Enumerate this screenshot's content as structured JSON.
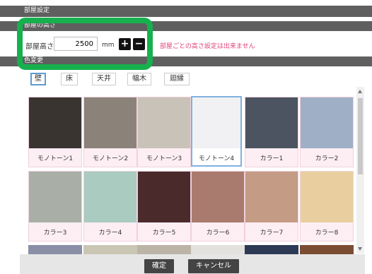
{
  "header": {
    "title": "部屋設定",
    "section_height": "部屋の高さ",
    "section_color": "色変更"
  },
  "height": {
    "label": "部屋高さ",
    "value": "2500",
    "unit": "mm",
    "plus": "+",
    "minus": "−",
    "warning": "部屋ごとの高さ設定は出来ません"
  },
  "tabs": [
    "壁",
    "床",
    "天井",
    "幅木",
    "廻縁"
  ],
  "tiles_row1": [
    {
      "label": "モノトーン1",
      "color": "#3a3431"
    },
    {
      "label": "モノトーン2",
      "color": "#8b8379"
    },
    {
      "label": "モノトーン3",
      "color": "#c8c2b9"
    },
    {
      "label": "モノトーン4",
      "color": "#f1f1f3"
    },
    {
      "label": "カラー1",
      "color": "#4c5461"
    },
    {
      "label": "カラー2",
      "color": "#9fb0c6"
    }
  ],
  "tiles_row2": [
    {
      "label": "カラー3",
      "color": "#a9afa6"
    },
    {
      "label": "カラー4",
      "color": "#a9cbc0"
    },
    {
      "label": "カラー5",
      "color": "#4a2a2a"
    },
    {
      "label": "カラー6",
      "color": "#a97a6e"
    },
    {
      "label": "カラー7",
      "color": "#c49b84"
    },
    {
      "label": "カラー8",
      "color": "#e9cf9f"
    }
  ],
  "tiles_row3_colors": [
    "#8a8ea6",
    "#c9c7b4",
    "#bcb4a6",
    "#e3e1dd",
    "#2d3a56",
    "#7b4d33"
  ],
  "footer": {
    "ok": "確定",
    "cancel": "キャンセル"
  },
  "accent": {
    "frame": "#16b04e",
    "selected": "#7fb1e0",
    "warning": "#e0457b"
  }
}
